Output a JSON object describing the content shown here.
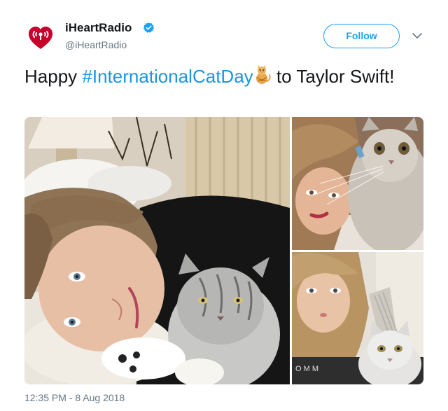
{
  "account": {
    "name": "iHeartRadio",
    "handle": "@iHeartRadio",
    "brand_color": "#c6002b",
    "verified_icon": "verified-badge-icon"
  },
  "actions": {
    "follow_label": "Follow",
    "more_icon": "chevron-down-icon"
  },
  "tweet": {
    "text_before": "Happy ",
    "hashtag": "#InternationalCatDay",
    "emoji": "cat-face-emoji",
    "text_after": " to Taylor Swift!"
  },
  "media": {
    "photos": [
      {
        "name": "photo-woman-with-cat-in-bed"
      },
      {
        "name": "photo-woman-with-cat-selfie"
      },
      {
        "name": "photo-woman-with-cat-closeup"
      }
    ]
  },
  "timestamp": "12:35 PM - 8 Aug 2018",
  "colors": {
    "link": "#1b95e0",
    "follow_blue": "#1da1f2",
    "muted": "#657786"
  }
}
